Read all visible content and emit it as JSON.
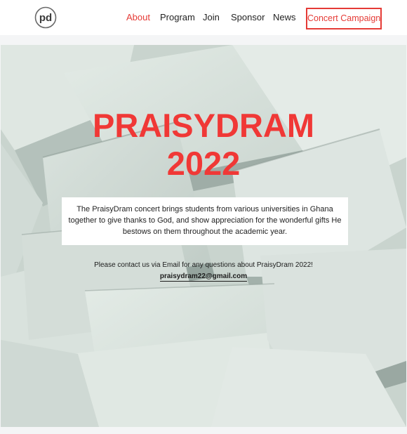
{
  "header": {
    "logo_text": "pd",
    "nav": [
      {
        "label": "About",
        "active": true
      },
      {
        "label": "Program",
        "active": false
      },
      {
        "label": "Join",
        "active": false
      },
      {
        "label": "Sponsor",
        "active": false
      },
      {
        "label": "News",
        "active": false
      }
    ],
    "cta_label": "Concert Campaign"
  },
  "hero": {
    "title_line1": "PRAISYDRAM",
    "title_line2": "2022",
    "description": "The PraisyDram concert brings students from various universities in Ghana together to give thanks to God, and show appreciation for the wonderful gifts He bestows on them throughout the academic year.",
    "contact_text": "Please contact us via Email for any questions about PraisyDram 2022!",
    "email": "praisydram22@gmail.com"
  },
  "colors": {
    "accent": "#e53b36",
    "title": "#f03836",
    "hero_bg": "#d3ddd8",
    "text": "#222222"
  }
}
